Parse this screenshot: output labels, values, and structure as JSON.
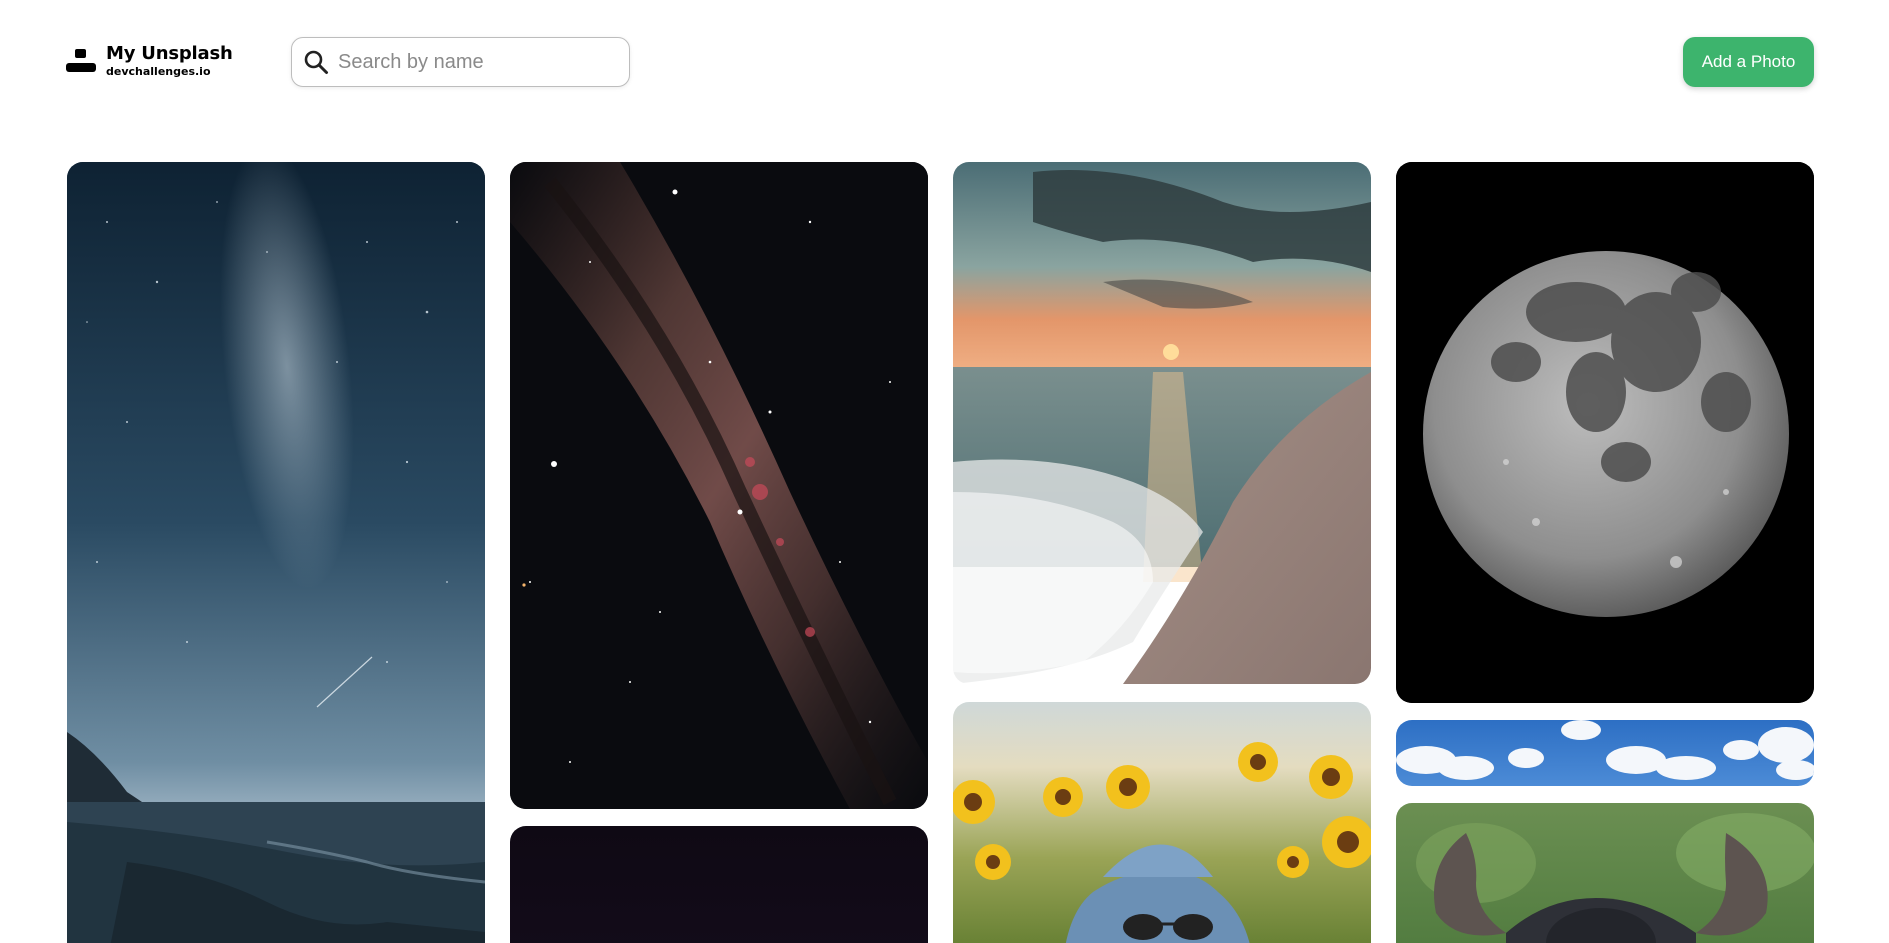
{
  "app": {
    "title": "My Unsplash",
    "subtitle": "devchallenges.io"
  },
  "search": {
    "placeholder": "Search by name",
    "value": "",
    "icon": "search-icon"
  },
  "actions": {
    "add_photo_label": "Add a Photo"
  },
  "colors": {
    "accent": "#3db46d",
    "text": "#000000",
    "placeholder": "#8a8a8a"
  },
  "gallery": {
    "photos": [
      {
        "id": "milky-way-over-sea"
      },
      {
        "id": "milky-way-galaxy"
      },
      {
        "id": "dark-starry-sky"
      },
      {
        "id": "sunset-beach"
      },
      {
        "id": "sunflower-with-hat"
      },
      {
        "id": "full-moon"
      },
      {
        "id": "blue-sky-clouds"
      },
      {
        "id": "buffalo"
      }
    ]
  }
}
